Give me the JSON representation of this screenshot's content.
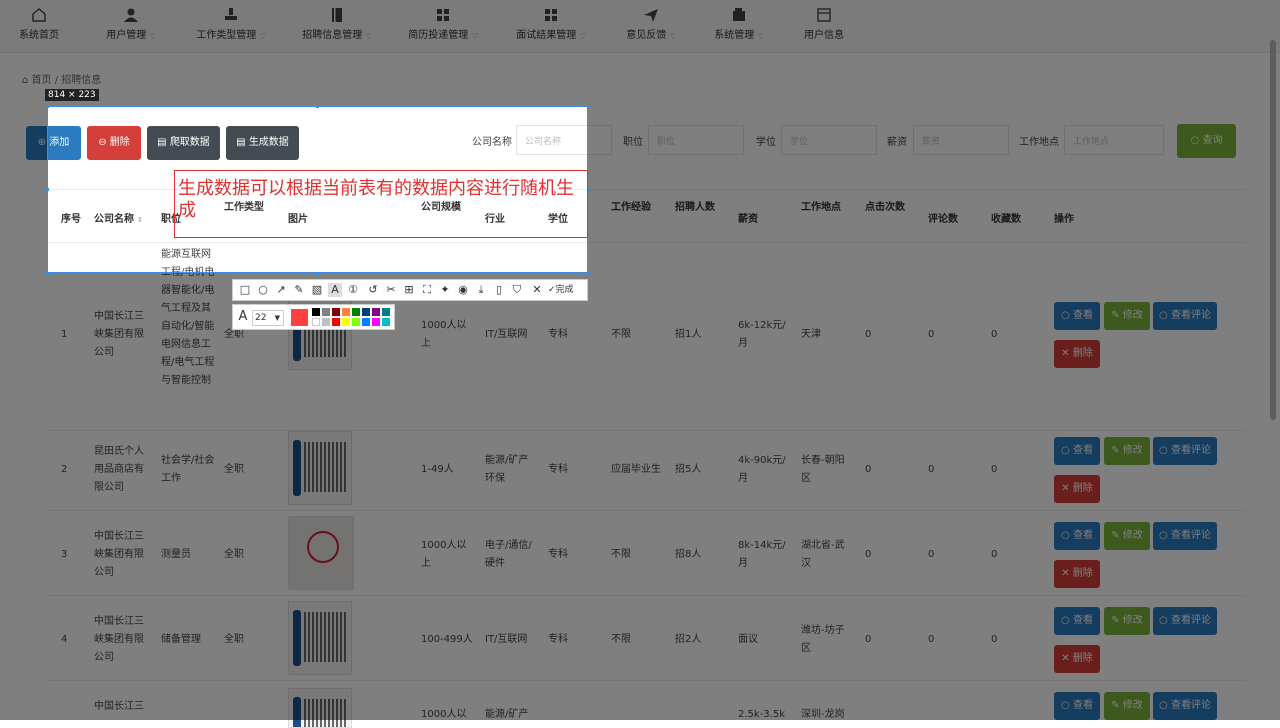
{
  "nav": {
    "items": [
      {
        "label": "系统首页",
        "icon": "home-icon"
      },
      {
        "label": "用户管理",
        "icon": "user-icon"
      },
      {
        "label": "工作类型管理",
        "icon": "stamp-icon"
      },
      {
        "label": "招聘信息管理",
        "icon": "book-icon"
      },
      {
        "label": "简历投递管理",
        "icon": "grid-icon"
      },
      {
        "label": "面试结果管理",
        "icon": "grid-icon"
      },
      {
        "label": "意见反馈",
        "icon": "send-icon"
      },
      {
        "label": "系统管理",
        "icon": "wallet-icon"
      },
      {
        "label": "用户信息",
        "icon": "window-icon"
      }
    ]
  },
  "breadcrumb": {
    "home": "首页",
    "sep": "/",
    "current": "招聘信息"
  },
  "toolbar": {
    "add": "添加",
    "delete": "删除",
    "crawl": "爬取数据",
    "generate": "生成数据",
    "search": "查询"
  },
  "filters": {
    "company_label": "公司名称",
    "company_placeholder": "公司名称",
    "position_label": "职位",
    "position_placeholder": "职位",
    "degree_label": "学位",
    "degree_placeholder": "学位",
    "salary_label": "薪资",
    "salary_placeholder": "薪资",
    "location_label": "工作地点",
    "location_placeholder": "工作地点"
  },
  "table": {
    "headers": {
      "idx": "序号",
      "company": "公司名称",
      "position": "职位",
      "jobtype": "工作类型",
      "picture": "图片",
      "scale": "公司规模",
      "industry": "行业",
      "degree": "学位",
      "experience": "工作经验",
      "hires": "招聘人数",
      "salary": "薪资",
      "location": "工作地点",
      "clicks": "点击次数",
      "comments": "评论数",
      "favs": "收藏数",
      "actions": "操作"
    },
    "row0_position": "能源互联网",
    "rows": [
      {
        "idx": "1",
        "company": "中国长江三峡集团有限公司",
        "position": "工程/电机电器智能化/电气工程及其自动化/智能电网信息工程/电气工程与智能控制",
        "jobtype": "全职",
        "scale": "1000人以上",
        "industry": "IT/互联网",
        "degree": "专科",
        "experience": "不限",
        "hires": "招1人",
        "salary": "6k-12k元/月",
        "location": "天津",
        "clicks": "0",
        "comments": "0",
        "favs": "0"
      },
      {
        "idx": "2",
        "company": "昆田氏个人用品商店有限公司",
        "position": "社会学/社会工作",
        "jobtype": "全职",
        "scale": "1-49人",
        "industry": "能源/矿产环保",
        "degree": "专科",
        "experience": "应届毕业生",
        "hires": "招5人",
        "salary": "4k-90k元/月",
        "location": "长春-朝阳区",
        "clicks": "0",
        "comments": "0",
        "favs": "0"
      },
      {
        "idx": "3",
        "company": "中国长江三峡集团有限公司",
        "position": "测量员",
        "jobtype": "全职",
        "scale": "1000人以上",
        "industry": "电子/通信/硬件",
        "degree": "专科",
        "experience": "不限",
        "hires": "招8人",
        "salary": "8k-14k元/月",
        "location": "湖北省-武汉",
        "clicks": "0",
        "comments": "0",
        "favs": "0"
      },
      {
        "idx": "4",
        "company": "中国长江三峡集团有限公司",
        "position": "储备管理",
        "jobtype": "全职",
        "scale": "100-499人",
        "industry": "IT/互联网",
        "degree": "专科",
        "experience": "不限",
        "hires": "招2人",
        "salary": "面议",
        "location": "潍坊-坊子区",
        "clicks": "0",
        "comments": "0",
        "favs": "0"
      },
      {
        "idx": "",
        "company": "中国长江三",
        "position": "",
        "jobtype": "",
        "scale": "1000人以",
        "industry": "能源/矿产",
        "degree": "",
        "experience": "",
        "hires": "",
        "salary": "2.5k-3.5k",
        "location": "深圳-龙岗",
        "clicks": "",
        "comments": "",
        "favs": ""
      }
    ],
    "actions": {
      "view": "查看",
      "edit": "修改",
      "comments": "查看评论",
      "delete": "删除"
    }
  },
  "capture": {
    "size_label": "814 × 223",
    "annotation": "生成数据可以根据当前表有的数据内容进行随机生成",
    "font_size": "22",
    "done": "完成",
    "active_color": "#ff4040",
    "palette": [
      "#000000",
      "#808080",
      "#800000",
      "#ff8040",
      "#008000",
      "#004080",
      "#800080",
      "#008080",
      "#ffffff",
      "#c0c0c0",
      "#ff0000",
      "#ffff00",
      "#80ff00",
      "#0080ff",
      "#ff00ff",
      "#00c0c0"
    ]
  }
}
